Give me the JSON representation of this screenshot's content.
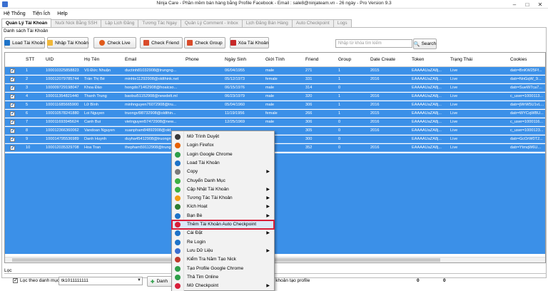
{
  "window": {
    "title": "Ninja Care - Phần mềm bán hàng bằng Profile Facebook - Email : sale8@ninjateam.vn - 26 ngày - Pro Version 9.3"
  },
  "menu": [
    "Hệ Thống",
    "Tiện Ích",
    "Help"
  ],
  "tabs": [
    "Quản Lý Tài Khoản",
    "Nuôi Nick Bằng SSH",
    "Lập Lịch Đăng",
    "Tương Tác Ngay",
    "Quản Lý Comment - Inbox",
    "Lịch Đăng Bán Hàng",
    "Auto Checkpoint",
    "Logs"
  ],
  "section_label": "Danh sách Tài Khoản",
  "toolbar": {
    "load": "Load Tài Khoản",
    "import": "Nhập Tài Khoản",
    "check_live": "Check Live",
    "check_friend": "Check Friend",
    "check_group": "Check Group",
    "delete": "Xóa Tài Khoản",
    "search_placeholder": "Nhập từ khóa tìm kiếm",
    "search": "Search"
  },
  "columns": [
    "STT",
    "UID",
    "Họ Tên",
    "Email",
    "Phone",
    "Ngày Sinh",
    "Giới Tính",
    "Friend",
    "Group",
    "Date Create",
    "Token",
    "Trạng Thái",
    "Cookies"
  ],
  "rows": [
    [
      "1",
      "100010325858823",
      "Vũ Đức Nhuận",
      "ductinh81032908@trungng...",
      "",
      "06/04/1955",
      "male",
      "271",
      "1",
      "2015",
      "EAAAAUaZA8j...",
      "Live",
      "datr=BnKW25Ff..."
    ],
    [
      "2",
      "100012079785744",
      "Trần Thị Bé",
      "minhle11292908@oldthink.net",
      "",
      "05/12/1973",
      "female",
      "331",
      "1",
      "2016",
      "EAAAAUaZA8j...",
      "Live",
      "datr=NnGqW_9..."
    ],
    [
      "3",
      "100009729198047",
      "Khoa Đào",
      "hongdo71462908@hoaicso...",
      "",
      "06/15/1976",
      "male",
      "314",
      "0",
      "",
      "EAAAAUaZA8j...",
      "Live",
      "datr=SueW7ca7..."
    ],
    [
      "4",
      "100011354821440",
      "Thanh Trung",
      "baobui51152908@newdelt.ml",
      "",
      "06/23/1979",
      "male",
      "320",
      "1",
      "2016",
      "EAAAAUaZA8j...",
      "Live",
      "c_user=1000113..."
    ],
    [
      "5",
      "100011685665900",
      "Lữ Bình",
      "minhnguyen76072908@tru...",
      "",
      "05/04/1960",
      "male",
      "306",
      "1",
      "2016",
      "EAAAAUaZA8j...",
      "Live",
      "datr=jWrW5U1vL..."
    ],
    [
      "6",
      "100010578241880",
      "Loi Nguyen",
      "truongvl98732908@oldthin...",
      "",
      "11/19/1956",
      "female",
      "266",
      "1",
      "2015",
      "EAAAAUaZA8j...",
      "Live",
      "datr=WYCqWBU..."
    ],
    [
      "7",
      "100011693945624",
      "Canh Bui",
      "vietnguyen57472908@new...",
      "",
      "12/25/1969",
      "male",
      "306",
      "0",
      "2016",
      "EAAAAUaZA8j...",
      "Live",
      "c_user=1000116..."
    ],
    [
      "8",
      "100012366360062",
      "Vandoan Nguyen",
      "xuanpham84892908@old...",
      "",
      "",
      "",
      "305",
      "0",
      "2016",
      "EAAAAUaZA8j...",
      "Live",
      "c_user=1000123..."
    ],
    [
      "9",
      "100014795536989",
      "Danh Huynh",
      "duyha45412908@truongng...",
      "",
      "",
      "",
      "300",
      "0",
      "",
      "EAAAAUaZA8j...",
      "Live",
      "datr=GcOrW0T2..."
    ],
    [
      "10",
      "100012035329708",
      "Hoa Tran",
      "thepham59112908@trungn...",
      "",
      "",
      "",
      "352",
      "0",
      "2016",
      "EAAAAUaZA8j...",
      "Live",
      "datr=YtmqW6U..."
    ]
  ],
  "context_menu": [
    {
      "label": "Mở Trình Duyệt",
      "icon": "globe-icon",
      "color": "#3a3a3a",
      "sub": false
    },
    {
      "label": "Login Firefox",
      "icon": "firefox-icon",
      "color": "#e66000",
      "sub": false
    },
    {
      "label": "Login Google Chrome",
      "icon": "chrome-icon",
      "color": "#2e9e49",
      "sub": false
    },
    {
      "label": "Load Tài Khoản",
      "icon": "load-icon",
      "color": "#1e73c8",
      "sub": false
    },
    {
      "label": "Copy",
      "icon": "copy-icon",
      "color": "#7a7a7a",
      "sub": true
    },
    {
      "label": "Chuyển Danh Mục",
      "icon": "move-icon",
      "color": "#3cb043",
      "sub": false
    },
    {
      "label": "Cập Nhật Tài Khoản",
      "icon": "update-icon",
      "color": "#3cb043",
      "sub": true
    },
    {
      "label": "Tương Tác Tài Khoản",
      "icon": "interact-icon",
      "color": "#f39c12",
      "sub": true
    },
    {
      "label": "Kích Hoạt",
      "icon": "activate-icon",
      "color": "#2e7d32",
      "sub": true
    },
    {
      "label": "Bạn Bè",
      "icon": "friends-icon",
      "color": "#1e73c8",
      "sub": true
    },
    {
      "label": "Thêm Tài Khoản Auto Checkpoint",
      "icon": "add-checkpoint-icon",
      "color": "#d81f3a",
      "sub": false
    },
    {
      "label": "Cài Đặt",
      "icon": "settings-icon",
      "color": "#1e73c8",
      "sub": true
    },
    {
      "label": "Re Login",
      "icon": "relogin-icon",
      "color": "#1e73c8",
      "sub": false
    },
    {
      "label": "Lưu Dữ Liệu",
      "icon": "save-icon",
      "color": "#3a6fd0",
      "sub": true
    },
    {
      "label": "Kiểm Tra Năm Tạo Nick",
      "icon": "calendar-icon",
      "color": "#c0392b",
      "sub": false
    },
    {
      "label": "Tạo Profile Google Chrome",
      "icon": "profile-icon",
      "color": "#2e9e49",
      "sub": false
    },
    {
      "label": "Thả Tim Online",
      "icon": "heart-icon",
      "color": "#2e9e49",
      "sub": false
    },
    {
      "label": "Mở Checkpoint",
      "icon": "checkpoint-icon",
      "color": "#d81f3a",
      "sub": true
    }
  ],
  "bottom": {
    "loc_label": "Lọc",
    "filter_label": "Lọc theo danh mục",
    "filter_value": "tk1011111111",
    "add_label": "Danh",
    "status_text": "i khoản tạo profile",
    "count_a": "0",
    "count_b": "0"
  }
}
